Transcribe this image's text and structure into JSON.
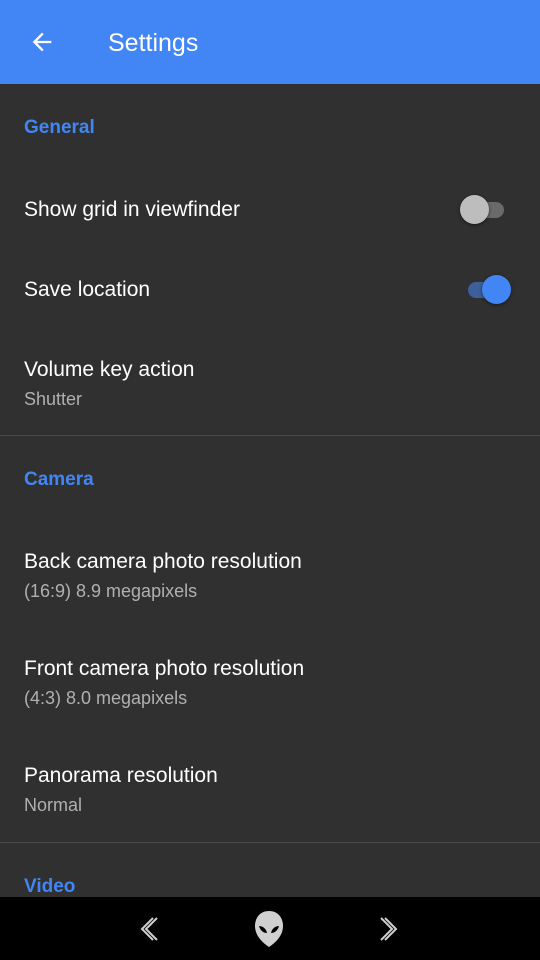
{
  "appbar": {
    "title": "Settings",
    "back_icon": "arrow-back-icon",
    "color": "#4285f4"
  },
  "sections": {
    "general": {
      "header": "General",
      "show_grid": {
        "title": "Show grid in viewfinder",
        "enabled": false
      },
      "save_location": {
        "title": "Save location",
        "enabled": true
      },
      "volume_key": {
        "title": "Volume key action",
        "summary": "Shutter"
      }
    },
    "camera": {
      "header": "Camera",
      "back_res": {
        "title": "Back camera photo resolution",
        "summary": "(16:9) 8.9 megapixels"
      },
      "front_res": {
        "title": "Front camera photo resolution",
        "summary": "(4:3) 8.0 megapixels"
      },
      "panorama": {
        "title": "Panorama resolution",
        "summary": "Normal"
      }
    },
    "video": {
      "header": "Video"
    }
  },
  "navbar": {
    "back_icon": "chevron-left-icon",
    "home_icon": "alien-head-icon",
    "forward_icon": "chevron-right-icon"
  },
  "colors": {
    "accent": "#4285f4",
    "background": "#303030",
    "navbar": "#000000"
  }
}
